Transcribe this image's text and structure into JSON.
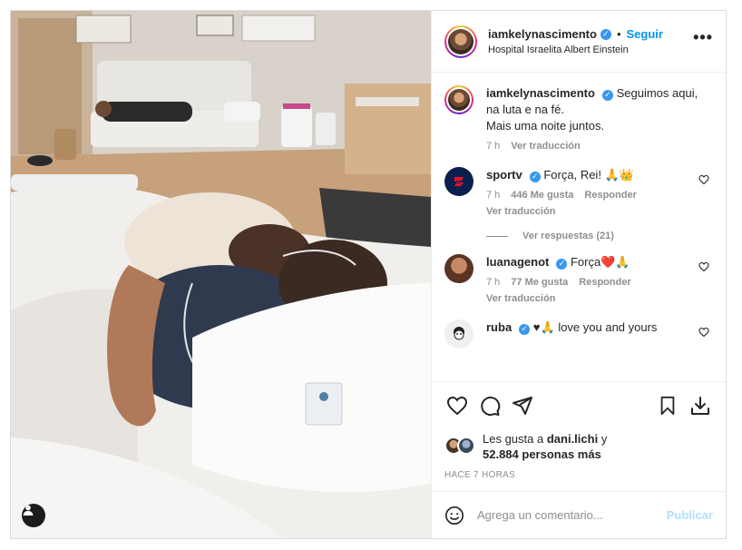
{
  "post": {
    "author": "iamkelynascimento",
    "follow_label": "Seguir",
    "separator": "•",
    "location": "Hospital Israelita Albert Einstein",
    "more_label": "•••"
  },
  "caption": {
    "username": "iamkelynascimento",
    "line1": "Seguimos aqui,",
    "line2": "na luta e na fé.",
    "line3": "Mais uma noite juntos.",
    "time": "7 h",
    "translate": "Ver traducción"
  },
  "comments": [
    {
      "username": "sportv",
      "text": "Força, Rei! 🙏👑",
      "time": "7 h",
      "likes": "446 Me gusta",
      "reply": "Responder",
      "translate": "Ver traducción",
      "avatar_color": "#0b1f4d"
    },
    {
      "username": "luanagenot",
      "text": "Força❤️🙏",
      "time": "7 h",
      "likes": "77 Me gusta",
      "reply": "Responder",
      "translate": "Ver traducción",
      "avatar_color": "#8a4a2e"
    },
    {
      "username": "ruba",
      "text": "♥🙏 love you and yours",
      "avatar_color": "#f0f0f0"
    }
  ],
  "view_replies": "Ver respuestas (21)",
  "likes": {
    "prefix": "Les gusta a",
    "user": "dani.lichi",
    "suffix": "y",
    "count": "52.884 personas más"
  },
  "timestamp": "HACE 7 HORAS",
  "comment_box": {
    "placeholder": "Agrega un comentario...",
    "publish": "Publicar"
  },
  "colors": {
    "accent": "#0095f6",
    "verified": "#3897f0",
    "muted": "#8e8e8e",
    "publish_disabled": "#b2dffc"
  },
  "icons": [
    "user-tag-icon",
    "verified-badge-icon",
    "more-options-icon",
    "heart-icon",
    "comment-icon",
    "share-icon",
    "bookmark-icon",
    "download-icon",
    "emoji-icon"
  ]
}
